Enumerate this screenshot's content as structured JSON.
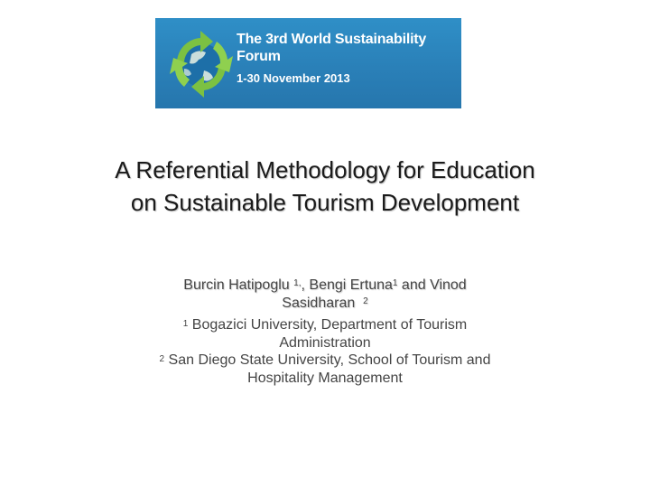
{
  "banner": {
    "title_line1": "The 3rd World Sustainability",
    "title_line2": "Forum",
    "date": "1-30 November 2013",
    "logo_icon": "recycle-globe-icon",
    "colors": {
      "background": "#2a80b8",
      "recycle_green": "#7cc142",
      "globe_blue": "#1d6fa8"
    }
  },
  "title": {
    "line1": "A Referential Methodology for Education",
    "line2": "on Sustainable Tourism Development"
  },
  "authors": {
    "author1_name": "Burcin Hatipoglu",
    "author1_sup": "1,",
    "separator": ",",
    "author2_name": "Bengi Ertuna",
    "author2_sup": "1",
    "conjunction": "and Vinod",
    "author3_lastname": "Sasidharan",
    "author3_sup": "2"
  },
  "affiliations": [
    {
      "sup": "1",
      "line1": "Bogazici University, Department of Tourism",
      "line2": "Administration"
    },
    {
      "sup": "2",
      "line1": "San Diego State University, School of Tourism and",
      "line2": "Hospitality Management"
    }
  ]
}
